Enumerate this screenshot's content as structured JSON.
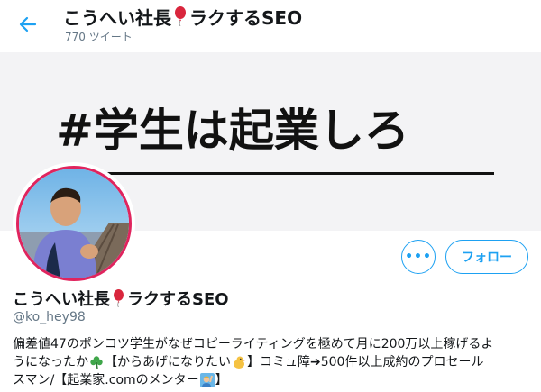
{
  "header": {
    "name_part1": "こうへい社長",
    "name_part2": "ラクするSEO",
    "tweet_count": "770 ツイート"
  },
  "banner": {
    "text": "#学生は起業しろ"
  },
  "actions": {
    "more_label": "•••",
    "follow_label": "フォロー"
  },
  "profile": {
    "name_part1": "こうへい社長",
    "name_part2": "ラクするSEO",
    "handle": "@ko_hey98",
    "bio_line1": "偏差値47のポンコツ学生がなぜコピーライティングを極めて月に200万以上稼げるよ",
    "bio_line2a": "うになったか",
    "bio_line2b": "【からあげになりたい",
    "bio_line2c": "】コミュ障➔500件以上成約のプロセール",
    "bio_line3a": "スマン/【起業家.comのメンター",
    "bio_line3b": "】"
  },
  "colors": {
    "accent": "#1da1f2",
    "secondary_text": "#657786",
    "avatar_ring": "#e0245e"
  },
  "icons": {
    "back": "arrow-left-icon",
    "balloon": "red-balloon-icon",
    "clover": "shamrock-icon",
    "chick": "chick-icon",
    "person": "person-raising-hand-icon"
  }
}
